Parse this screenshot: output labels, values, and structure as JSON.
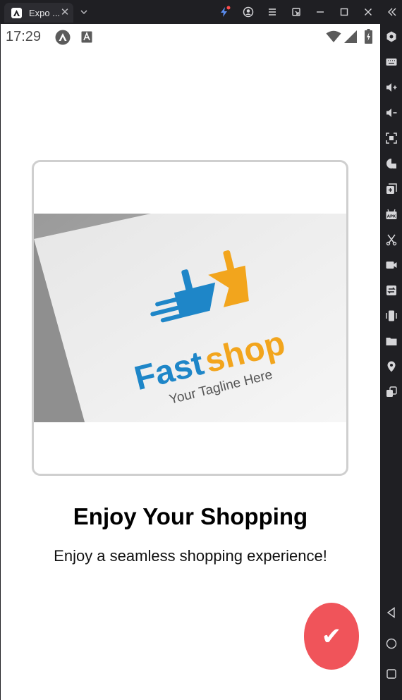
{
  "window": {
    "tab_title": "Expo ...",
    "tab_close_icon": "close-icon",
    "tab_dropdown_icon": "chevron-down-icon",
    "toolbar_icons": [
      "lightning-icon",
      "account-icon",
      "menu-icon",
      "window-export-icon",
      "minimize-icon",
      "maximize-icon",
      "close-icon",
      "collapse-sidebar-icon"
    ]
  },
  "emulator_sidebar": {
    "icons": [
      "settings-hex-icon",
      "keyboard-icon",
      "volume-up-icon",
      "volume-down-icon",
      "screenshot-icon",
      "rotate-lock-icon",
      "multi-window-icon",
      "apk-install-icon",
      "scissors-icon",
      "record-video-icon",
      "sync-icon",
      "shake-icon",
      "folder-icon",
      "location-icon",
      "multi-instance-icon",
      "back-nav-icon",
      "home-nav-icon",
      "recents-nav-icon"
    ]
  },
  "status_bar": {
    "time": "17:29",
    "left_icons": [
      "expo-go-icon",
      "text-a-icon"
    ],
    "right_icons": [
      "wifi-icon",
      "signal-icon",
      "battery-icon"
    ]
  },
  "onboarding": {
    "image_alt": "Fastshop logo",
    "logo_word_1": "Fast",
    "logo_word_2": "shop",
    "logo_tagline": "Your Tagline Here",
    "title": "Enjoy Your Shopping",
    "subtitle": "Enjoy a seamless shopping experience!",
    "done_button_symbol": "✔",
    "colors": {
      "accent": "#f0545a",
      "logo_blue": "#1e86c8",
      "logo_orange": "#f2a51d",
      "card_border": "#cfcfcf"
    }
  }
}
